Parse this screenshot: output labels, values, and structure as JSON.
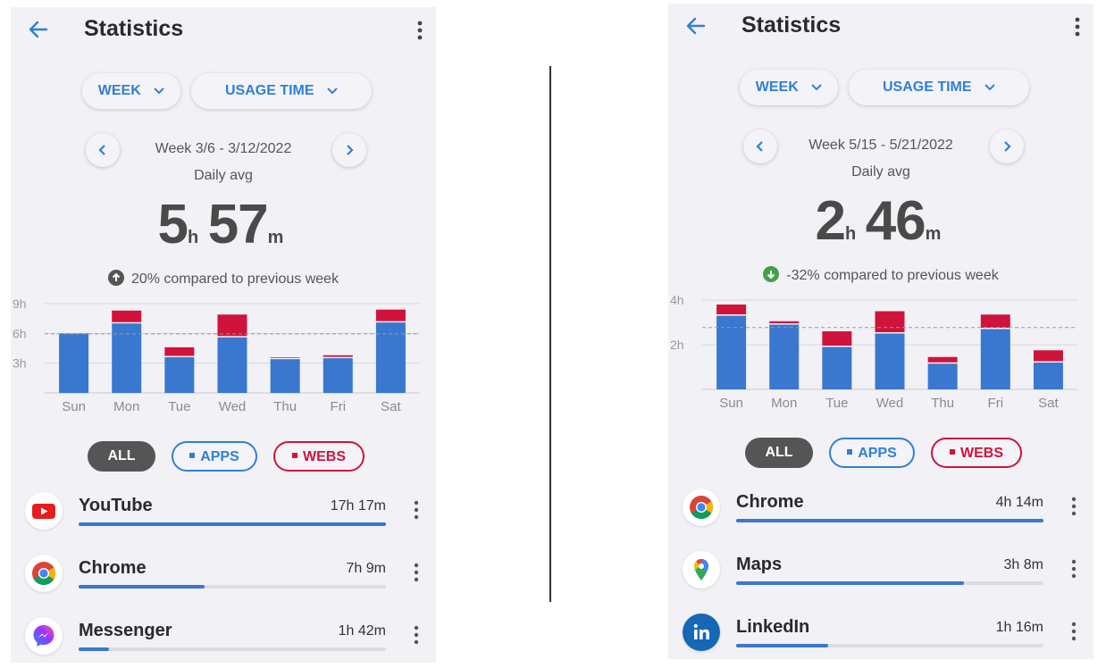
{
  "colors": {
    "accent": "#2f7fd8",
    "apps_bar": "#3a77cf",
    "webs_bar": "#d0133b",
    "up": "#555555",
    "down": "#43a047"
  },
  "panels": [
    {
      "title": "Statistics",
      "period_label": "WEEK",
      "metric_label": "USAGE TIME",
      "week_label": "Week 3/6 - 3/12/2022",
      "daily_label": "Daily avg",
      "avg_hours": "5",
      "avg_minutes": "57",
      "unit_h": "h",
      "unit_m": "m",
      "compare_text": "20% compared to previous week",
      "compare_direction": "up",
      "filters": {
        "all": "ALL",
        "apps": "APPS",
        "webs": "WEBS"
      },
      "chart_data": {
        "type": "bar",
        "stacked": true,
        "categories": [
          "Sun",
          "Mon",
          "Tue",
          "Wed",
          "Thu",
          "Fri",
          "Sat"
        ],
        "series": [
          {
            "name": "APPS",
            "values": [
              6.0,
              7.0,
              3.6,
              5.6,
              3.4,
              3.5,
              7.1
            ]
          },
          {
            "name": "WEBS",
            "values": [
              0.0,
              1.3,
              1.0,
              2.3,
              0.2,
              0.3,
              1.3
            ]
          }
        ],
        "average": 5.95,
        "y_ticks": [
          "3h",
          "6h",
          "9h"
        ],
        "y_tick_values": [
          3,
          6,
          9
        ],
        "ylim": [
          0,
          9
        ],
        "grid": true
      },
      "apps": [
        {
          "name": "YouTube",
          "time": "17h 17m",
          "share": 1.0,
          "icon": "youtube-icon"
        },
        {
          "name": "Chrome",
          "time": "7h 9m",
          "share": 0.41,
          "icon": "chrome-icon"
        },
        {
          "name": "Messenger",
          "time": "1h 42m",
          "share": 0.1,
          "icon": "messenger-icon"
        }
      ]
    },
    {
      "title": "Statistics",
      "period_label": "WEEK",
      "metric_label": "USAGE TIME",
      "week_label": "Week 5/15 - 5/21/2022",
      "daily_label": "Daily avg",
      "avg_hours": "2",
      "avg_minutes": "46",
      "unit_h": "h",
      "unit_m": "m",
      "compare_text": "-32% compared to previous week",
      "compare_direction": "down",
      "filters": {
        "all": "ALL",
        "apps": "APPS",
        "webs": "WEBS"
      },
      "chart_data": {
        "type": "bar",
        "stacked": true,
        "categories": [
          "Sun",
          "Mon",
          "Tue",
          "Wed",
          "Thu",
          "Fri",
          "Sat"
        ],
        "series": [
          {
            "name": "APPS",
            "values": [
              3.3,
              2.9,
              1.9,
              2.5,
              1.15,
              2.7,
              1.2
            ]
          },
          {
            "name": "WEBS",
            "values": [
              0.5,
              0.15,
              0.7,
              1.0,
              0.3,
              0.65,
              0.55
            ]
          }
        ],
        "average": 2.77,
        "y_ticks": [
          "2h",
          "4h"
        ],
        "y_tick_values": [
          2,
          4
        ],
        "ylim": [
          0,
          4
        ],
        "grid": true
      },
      "apps": [
        {
          "name": "Chrome",
          "time": "4h 14m",
          "share": 1.0,
          "icon": "chrome-icon"
        },
        {
          "name": "Maps",
          "time": "3h 8m",
          "share": 0.74,
          "icon": "maps-icon"
        },
        {
          "name": "LinkedIn",
          "time": "1h 16m",
          "share": 0.3,
          "icon": "linkedin-icon"
        }
      ]
    }
  ]
}
